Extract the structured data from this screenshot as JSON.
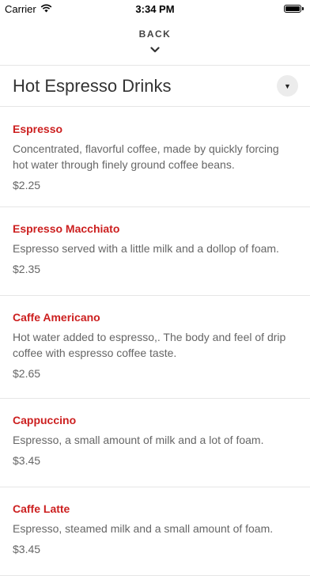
{
  "status_bar": {
    "carrier": "Carrier",
    "time": "3:34 PM",
    "wifi_icon": "wifi-icon",
    "battery_icon": "battery-icon"
  },
  "nav": {
    "back_label": "BACK",
    "chevron_icon": "chevron-down-icon"
  },
  "section": {
    "title": "Hot Espresso Drinks",
    "dropdown_icon": "caret-down-icon"
  },
  "items": [
    {
      "name": "Espresso",
      "description": "Concentrated, flavorful coffee, made by quickly forcing hot water through finely ground coffee beans.",
      "price": "$2.25"
    },
    {
      "name": "Espresso Macchiato",
      "description": "Espresso served with a little milk and a dollop of foam.",
      "price": "$2.35"
    },
    {
      "name": "Caffe Americano",
      "description": "Hot water added to espresso,. The body and feel of drip coffee with espresso coffee taste.",
      "price": "$2.65"
    },
    {
      "name": "Cappuccino",
      "description": "Espresso, a small amount of milk and a lot of foam.",
      "price": "$3.45"
    },
    {
      "name": "Caffe Latte",
      "description": "Espresso, steamed milk and a small amount of foam.",
      "price": "$3.45"
    }
  ],
  "colors": {
    "accent": "#cc1f1f",
    "text_secondary": "#666666",
    "divider": "#e6e6e6"
  }
}
